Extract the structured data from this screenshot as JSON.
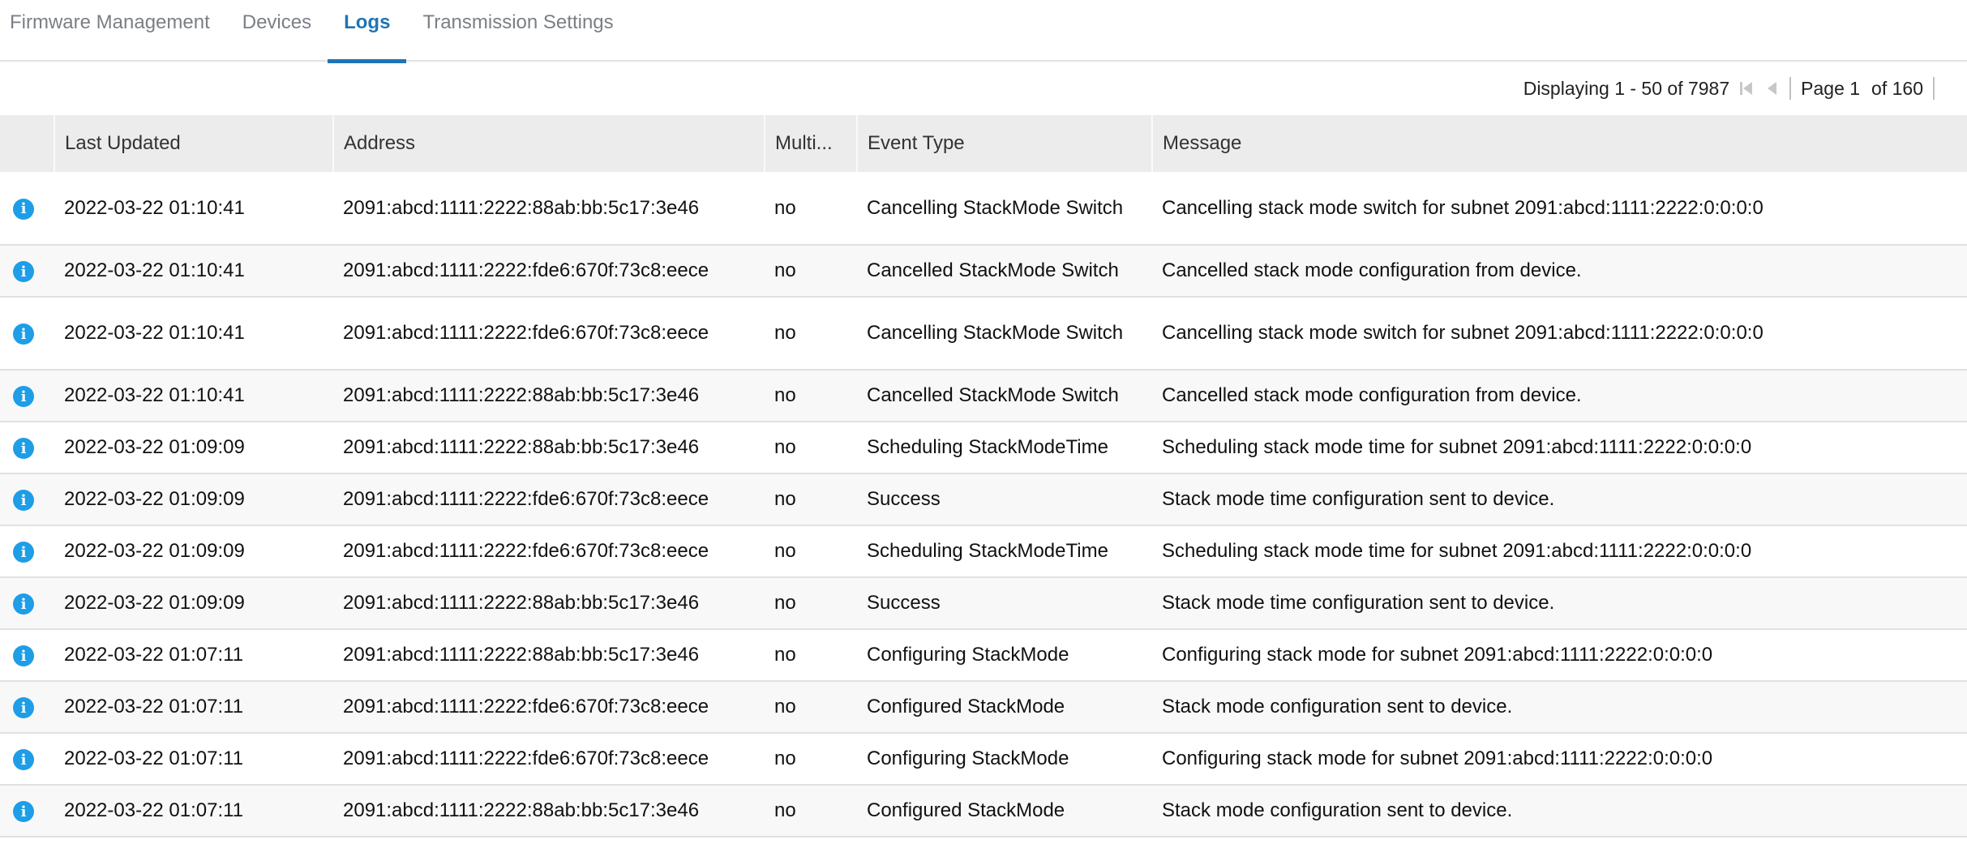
{
  "tabs": [
    {
      "label": "Firmware Management",
      "active": false
    },
    {
      "label": "Devices",
      "active": false
    },
    {
      "label": "Logs",
      "active": true
    },
    {
      "label": "Transmission Settings",
      "active": false
    }
  ],
  "pager": {
    "displaying": "Displaying 1 - 50 of 7987",
    "page_label": "Page 1",
    "of_label": "of 160"
  },
  "table": {
    "columns": [
      "",
      "Last Updated",
      "Address",
      "Multi...",
      "Event Type",
      "Message"
    ],
    "rows": [
      {
        "icon": "info-icon",
        "last_updated": "2022-03-22 01:10:41",
        "address": "2091:abcd:1111:2222:88ab:bb:5c17:3e46",
        "multi": "no",
        "event_type": "Cancelling StackMode Switch",
        "message": "Cancelling stack mode switch for subnet 2091:abcd:1111:2222:0:0:0:0"
      },
      {
        "icon": "info-icon",
        "last_updated": "2022-03-22 01:10:41",
        "address": "2091:abcd:1111:2222:fde6:670f:73c8:eece",
        "multi": "no",
        "event_type": "Cancelled StackMode Switch",
        "message": "Cancelled stack mode configuration from device."
      },
      {
        "icon": "info-icon",
        "last_updated": "2022-03-22 01:10:41",
        "address": "2091:abcd:1111:2222:fde6:670f:73c8:eece",
        "multi": "no",
        "event_type": "Cancelling StackMode Switch",
        "message": "Cancelling stack mode switch for subnet 2091:abcd:1111:2222:0:0:0:0"
      },
      {
        "icon": "info-icon",
        "last_updated": "2022-03-22 01:10:41",
        "address": "2091:abcd:1111:2222:88ab:bb:5c17:3e46",
        "multi": "no",
        "event_type": "Cancelled StackMode Switch",
        "message": "Cancelled stack mode configuration from device."
      },
      {
        "icon": "info-icon",
        "last_updated": "2022-03-22 01:09:09",
        "address": "2091:abcd:1111:2222:88ab:bb:5c17:3e46",
        "multi": "no",
        "event_type": "Scheduling StackModeTime",
        "message": "Scheduling stack mode time for subnet 2091:abcd:1111:2222:0:0:0:0"
      },
      {
        "icon": "info-icon",
        "last_updated": "2022-03-22 01:09:09",
        "address": "2091:abcd:1111:2222:fde6:670f:73c8:eece",
        "multi": "no",
        "event_type": "Success",
        "message": "Stack mode time configuration sent to device."
      },
      {
        "icon": "info-icon",
        "last_updated": "2022-03-22 01:09:09",
        "address": "2091:abcd:1111:2222:fde6:670f:73c8:eece",
        "multi": "no",
        "event_type": "Scheduling StackModeTime",
        "message": "Scheduling stack mode time for subnet 2091:abcd:1111:2222:0:0:0:0"
      },
      {
        "icon": "info-icon",
        "last_updated": "2022-03-22 01:09:09",
        "address": "2091:abcd:1111:2222:88ab:bb:5c17:3e46",
        "multi": "no",
        "event_type": "Success",
        "message": "Stack mode time configuration sent to device."
      },
      {
        "icon": "info-icon",
        "last_updated": "2022-03-22 01:07:11",
        "address": "2091:abcd:1111:2222:88ab:bb:5c17:3e46",
        "multi": "no",
        "event_type": "Configuring StackMode",
        "message": "Configuring stack mode for subnet 2091:abcd:1111:2222:0:0:0:0"
      },
      {
        "icon": "info-icon",
        "last_updated": "2022-03-22 01:07:11",
        "address": "2091:abcd:1111:2222:fde6:670f:73c8:eece",
        "multi": "no",
        "event_type": "Configured StackMode",
        "message": "Stack mode configuration sent to device."
      },
      {
        "icon": "info-icon",
        "last_updated": "2022-03-22 01:07:11",
        "address": "2091:abcd:1111:2222:fde6:670f:73c8:eece",
        "multi": "no",
        "event_type": "Configuring StackMode",
        "message": "Configuring stack mode for subnet 2091:abcd:1111:2222:0:0:0:0"
      },
      {
        "icon": "info-icon",
        "last_updated": "2022-03-22 01:07:11",
        "address": "2091:abcd:1111:2222:88ab:bb:5c17:3e46",
        "multi": "no",
        "event_type": "Configured StackMode",
        "message": "Stack mode configuration sent to device."
      }
    ]
  },
  "colors": {
    "accent": "#1f74b5",
    "info": "#1d9ee6",
    "header_bg": "#ececec"
  }
}
